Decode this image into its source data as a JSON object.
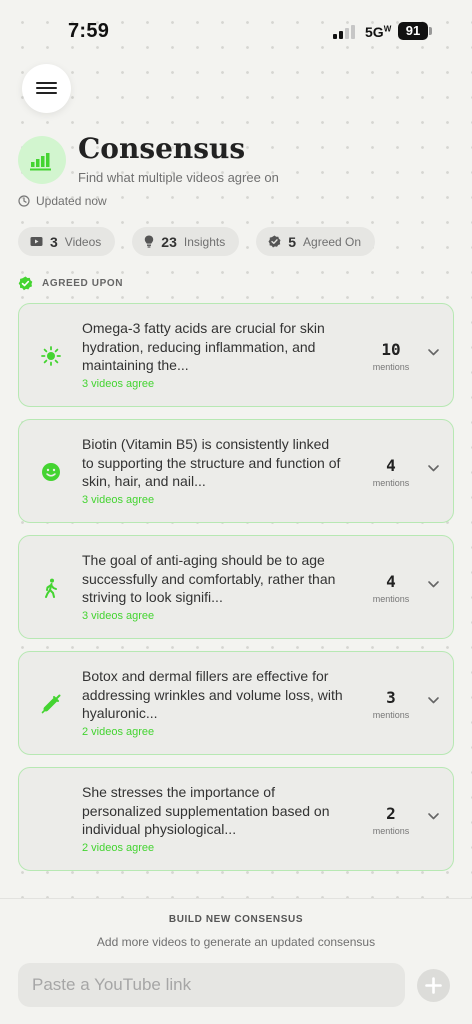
{
  "status_bar": {
    "time": "7:59",
    "network": "5G",
    "battery": "91"
  },
  "header": {
    "title": "Consensus",
    "subtitle": "Find what multiple videos agree on",
    "updated": "Updated now"
  },
  "stats": [
    {
      "value": "3",
      "label": "Videos",
      "icon": "video-icon"
    },
    {
      "value": "23",
      "label": "Insights",
      "icon": "lightbulb-icon"
    },
    {
      "value": "5",
      "label": "Agreed On",
      "icon": "verified-badge-icon"
    }
  ],
  "section": {
    "title": "AGREED UPON"
  },
  "items": [
    {
      "text": "Omega-3 fatty acids are crucial for skin hydration, reducing inflammation, and maintaining the...",
      "agree": "3 videos agree",
      "count": "10",
      "mentions_label": "mentions",
      "icon": "sun-icon"
    },
    {
      "text": "Biotin (Vitamin B5) is consistently linked to supporting the structure and function of skin, hair, and nail...",
      "agree": "3 videos agree",
      "count": "4",
      "mentions_label": "mentions",
      "icon": "smiley-face-icon"
    },
    {
      "text": "The goal of anti-aging should be to age successfully and comfortably, rather than striving to look signifi...",
      "agree": "3 videos agree",
      "count": "4",
      "mentions_label": "mentions",
      "icon": "walking-person-icon"
    },
    {
      "text": "Botox and dermal fillers are effective for addressing wrinkles and volume loss, with hyaluronic...",
      "agree": "2 videos agree",
      "count": "3",
      "mentions_label": "mentions",
      "icon": "syringe-icon"
    },
    {
      "text": "She stresses the importance of personalized supplementation based on individual physiological...",
      "agree": "2 videos agree",
      "count": "2",
      "mentions_label": "mentions",
      "icon": ""
    }
  ],
  "build": {
    "title": "BUILD NEW CONSENSUS",
    "subtitle": "Add more videos to generate an updated consensus",
    "input_placeholder": "Paste a YouTube link",
    "add_icon": "plus-icon"
  },
  "colors": {
    "accent": "#44d431",
    "card_border": "#b7e8b3",
    "logo_bg": "#d2f5cf"
  }
}
